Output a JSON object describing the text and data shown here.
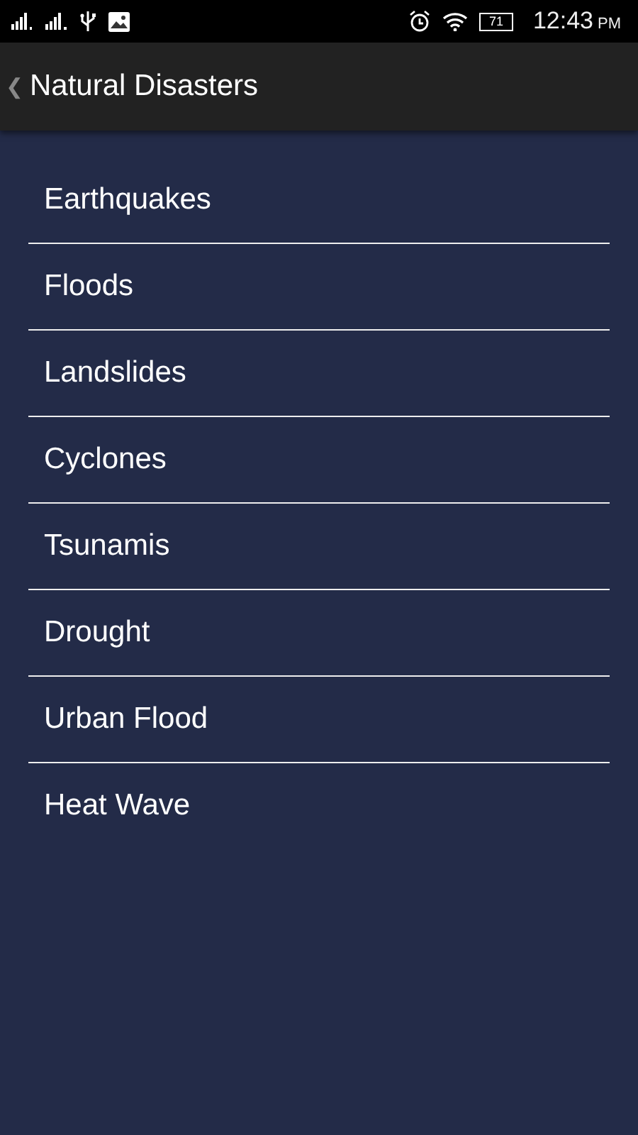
{
  "status_bar": {
    "battery": "71",
    "time": "12:43",
    "ampm": "PM"
  },
  "app_bar": {
    "back": "❮",
    "title": "Natural Disasters"
  },
  "items": [
    {
      "label": "Earthquakes"
    },
    {
      "label": "Floods"
    },
    {
      "label": "Landslides"
    },
    {
      "label": "Cyclones"
    },
    {
      "label": "Tsunamis"
    },
    {
      "label": "Drought"
    },
    {
      "label": "Urban Flood"
    },
    {
      "label": "Heat Wave"
    }
  ]
}
